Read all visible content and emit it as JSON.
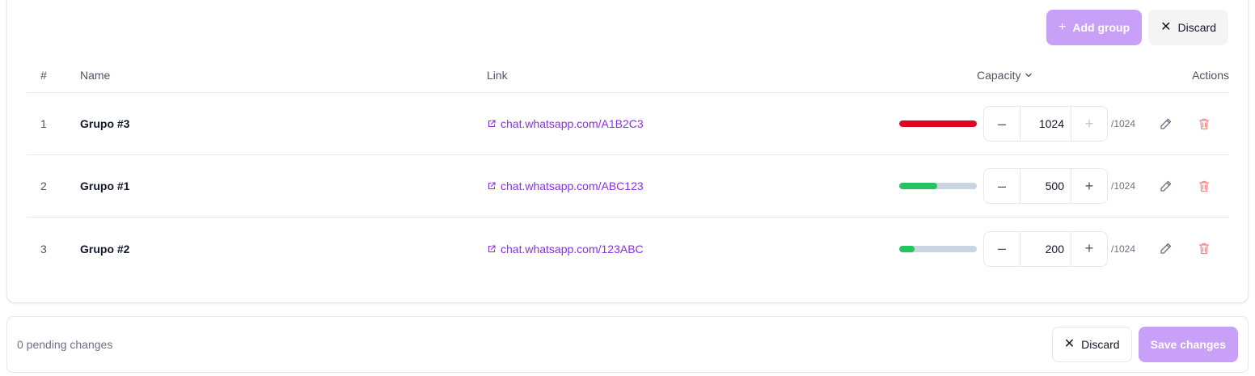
{
  "colors": {
    "accent": "#8b2fe0",
    "accent_disabled": "#c9a0f8",
    "bar_full": "#e0061f",
    "bar_ok": "#22c55e",
    "bar_track": "#cbd5e1",
    "delete": "#f08a8a"
  },
  "toolbar": {
    "add_group_label": "Add group",
    "discard_label": "Discard"
  },
  "table": {
    "headers": {
      "num": "#",
      "name": "Name",
      "link": "Link",
      "capacity": "Capacity",
      "actions": "Actions"
    },
    "rows": [
      {
        "num": "1",
        "name": "Grupo #3",
        "link": "chat.whatsapp.com/A1B2C3",
        "capacity": "1024",
        "max": "/1024",
        "fill": 1.0,
        "bar_color": "#e0061f",
        "plus_disabled": true
      },
      {
        "num": "2",
        "name": "Grupo #1",
        "link": "chat.whatsapp.com/ABC123",
        "capacity": "500",
        "max": "/1024",
        "fill": 0.488,
        "bar_color": "#22c55e",
        "plus_disabled": false
      },
      {
        "num": "3",
        "name": "Grupo #2",
        "link": "chat.whatsapp.com/123ABC",
        "capacity": "200",
        "max": "/1024",
        "fill": 0.195,
        "bar_color": "#22c55e",
        "plus_disabled": false
      }
    ]
  },
  "footer": {
    "pending_text": "0 pending changes",
    "discard_label": "Discard",
    "save_label": "Save changes"
  }
}
